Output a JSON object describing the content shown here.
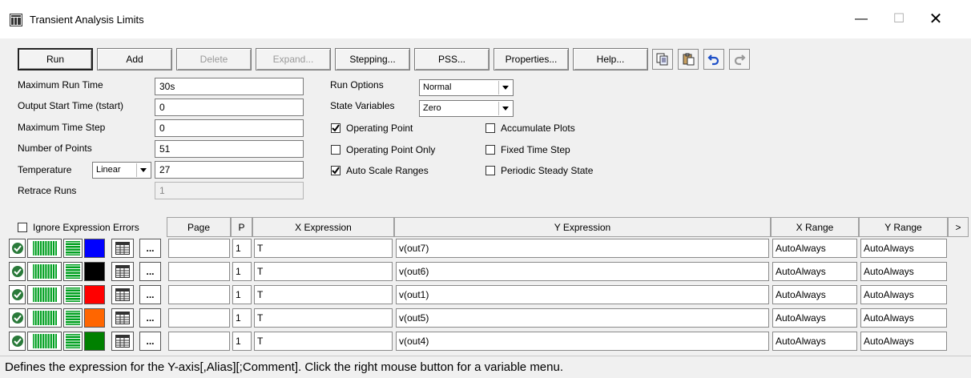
{
  "window": {
    "title": "Transient Analysis Limits"
  },
  "toolbar": {
    "run": "Run",
    "add": "Add",
    "delete": "Delete",
    "expand": "Expand...",
    "stepping": "Stepping...",
    "pss": "PSS...",
    "properties": "Properties...",
    "help": "Help..."
  },
  "fields": {
    "max_run_time_label": "Maximum Run Time",
    "max_run_time": "30s",
    "output_start_label": "Output Start Time (tstart)",
    "output_start": "0",
    "max_time_step_label": "Maximum Time Step",
    "max_time_step": "0",
    "num_points_label": "Number of Points",
    "num_points": "51",
    "temperature_label": "Temperature",
    "temperature_mode": "Linear",
    "temperature": "27",
    "retrace_label": "Retrace Runs",
    "retrace": "1"
  },
  "options": {
    "run_options_label": "Run Options",
    "run_options": "Normal",
    "state_variables_label": "State Variables",
    "state_variables": "Zero",
    "operating_point": "Operating Point",
    "operating_point_only": "Operating Point Only",
    "auto_scale": "Auto Scale Ranges",
    "accumulate": "Accumulate Plots",
    "fixed_time_step": "Fixed Time Step",
    "periodic": "Periodic Steady State"
  },
  "table": {
    "ignore_errors": "Ignore Expression Errors",
    "headers": {
      "page": "Page",
      "p": "P",
      "x_expr": "X Expression",
      "y_expr": "Y Expression",
      "x_range": "X Range",
      "y_range": "Y Range",
      "more": ">"
    },
    "rows": [
      {
        "color": "#0000ff",
        "p": "1",
        "x": "T",
        "y": "v(out7)",
        "xr": "AutoAlways",
        "yr": "AutoAlways"
      },
      {
        "color": "#000000",
        "p": "1",
        "x": "T",
        "y": "v(out6)",
        "xr": "AutoAlways",
        "yr": "AutoAlways"
      },
      {
        "color": "#ff0000",
        "p": "1",
        "x": "T",
        "y": "v(out1)",
        "xr": "AutoAlways",
        "yr": "AutoAlways"
      },
      {
        "color": "#ff6600",
        "p": "1",
        "x": "T",
        "y": "v(out5)",
        "xr": "AutoAlways",
        "yr": "AutoAlways"
      },
      {
        "color": "#008000",
        "p": "1",
        "x": "T",
        "y": "v(out4)",
        "xr": "AutoAlways",
        "yr": "AutoAlways"
      }
    ],
    "more_btn": "..."
  },
  "status": "Defines the expression for the Y-axis[,Alias][;Comment]. Click the right mouse button for a variable menu."
}
